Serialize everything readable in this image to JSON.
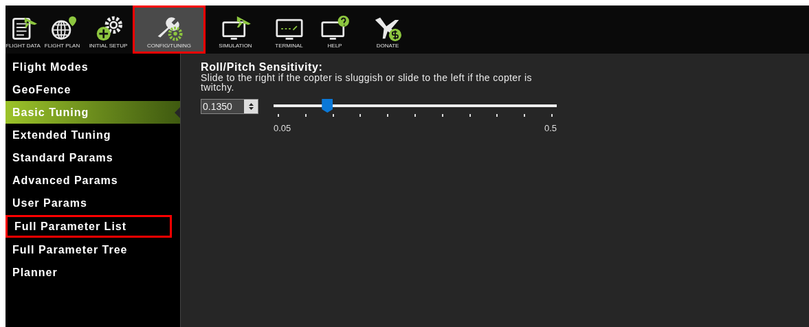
{
  "toolbar": [
    {
      "label": "FLIGHT DATA",
      "selected": false,
      "highlighted": false
    },
    {
      "label": "FLIGHT PLAN",
      "selected": false,
      "highlighted": false
    },
    {
      "label": "INITIAL SETUP",
      "selected": false,
      "highlighted": false
    },
    {
      "label": "CONFIG/TUNING",
      "selected": true,
      "highlighted": true
    },
    {
      "label": "SIMULATION",
      "selected": false,
      "highlighted": false
    },
    {
      "label": "TERMINAL",
      "selected": false,
      "highlighted": false
    },
    {
      "label": "HELP",
      "selected": false,
      "highlighted": false
    },
    {
      "label": "DONATE",
      "selected": false,
      "highlighted": false
    }
  ],
  "sidebar": {
    "items": [
      {
        "label": "Flight Modes",
        "selected": false,
        "highlighted": false
      },
      {
        "label": "GeoFence",
        "selected": false,
        "highlighted": false
      },
      {
        "label": "Basic Tuning",
        "selected": true,
        "highlighted": false
      },
      {
        "label": "Extended Tuning",
        "selected": false,
        "highlighted": false
      },
      {
        "label": "Standard Params",
        "selected": false,
        "highlighted": false
      },
      {
        "label": "Advanced Params",
        "selected": false,
        "highlighted": false
      },
      {
        "label": "User Params",
        "selected": false,
        "highlighted": false
      },
      {
        "label": "Full Parameter List",
        "selected": false,
        "highlighted": true
      },
      {
        "label": "Full Parameter Tree",
        "selected": false,
        "highlighted": false
      },
      {
        "label": "Planner",
        "selected": false,
        "highlighted": false
      }
    ]
  },
  "setting": {
    "title": "Roll/Pitch Sensitivity:",
    "description": "Slide to the right if the copter is sluggish or slide to the left if the copter is twitchy.",
    "value": "0.1350",
    "slider": {
      "level": 0.19,
      "min_label": "0.05",
      "max_label": "0.5"
    }
  }
}
